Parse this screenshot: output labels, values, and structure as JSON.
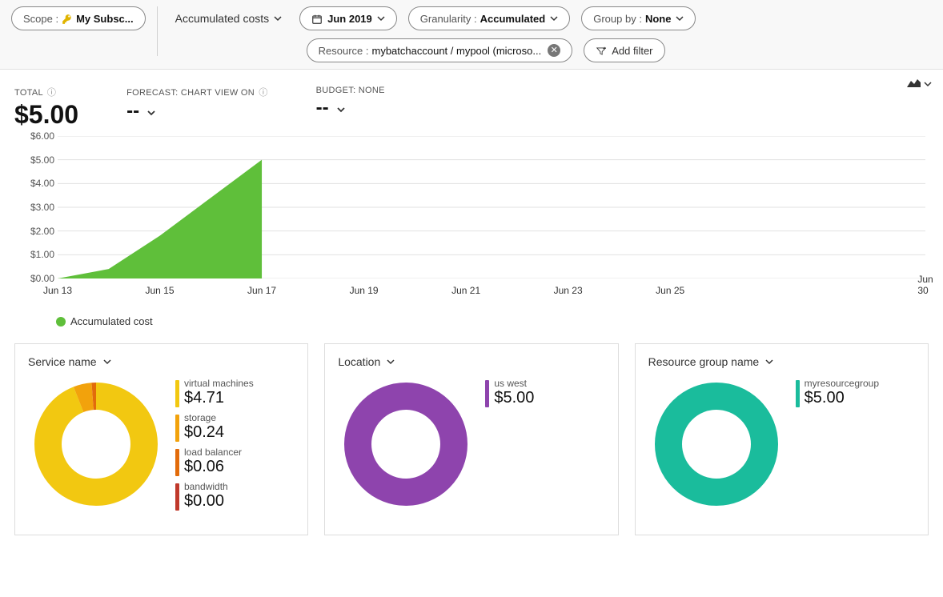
{
  "topbar": {
    "scope": {
      "label": "Scope :",
      "value": "My Subsc..."
    },
    "view": {
      "label": "Accumulated costs"
    },
    "period": {
      "value": "Jun 2019"
    },
    "granularity": {
      "label": "Granularity :",
      "value": "Accumulated"
    },
    "groupby": {
      "label": "Group by :",
      "value": "None"
    },
    "resource": {
      "label": "Resource :",
      "value": "mybatchaccount / mypool (microso..."
    },
    "addfilter": {
      "label": "Add filter"
    }
  },
  "kpi": {
    "total": {
      "label": "TOTAL",
      "value": "$5.00"
    },
    "forecast": {
      "label": "FORECAST: CHART VIEW ON",
      "value": "--"
    },
    "budget": {
      "label": "BUDGET: NONE",
      "value": "--"
    }
  },
  "legend_label": "Accumulated cost",
  "cards": [
    {
      "title": "Service name",
      "items": [
        {
          "name": "virtual machines",
          "value": "$4.71",
          "color": "#f2c811"
        },
        {
          "name": "storage",
          "value": "$0.24",
          "color": "#f2a20c"
        },
        {
          "name": "load balancer",
          "value": "$0.06",
          "color": "#e26b0a"
        },
        {
          "name": "bandwidth",
          "value": "$0.00",
          "color": "#c0392b"
        }
      ]
    },
    {
      "title": "Location",
      "items": [
        {
          "name": "us west",
          "value": "$5.00",
          "color": "#8e44ad"
        }
      ]
    },
    {
      "title": "Resource group name",
      "items": [
        {
          "name": "myresourcegroup",
          "value": "$5.00",
          "color": "#1abc9c"
        }
      ]
    }
  ],
  "chart_data": {
    "type": "area",
    "title": "",
    "xlabel": "",
    "ylabel": "",
    "ylim": [
      0,
      6
    ],
    "yticks": [
      "$0.00",
      "$1.00",
      "$2.00",
      "$3.00",
      "$4.00",
      "$5.00",
      "$6.00"
    ],
    "x_categories": [
      "Jun 13",
      "Jun 15",
      "Jun 17",
      "Jun 19",
      "Jun 21",
      "Jun 23",
      "Jun 25",
      "Jun 30"
    ],
    "series": [
      {
        "name": "Accumulated cost",
        "color": "#5fbf3a",
        "x": [
          "Jun 13",
          "Jun 14",
          "Jun 15",
          "Jun 16",
          "Jun 17"
        ],
        "y": [
          0.0,
          0.4,
          1.8,
          3.4,
          5.0
        ]
      }
    ],
    "donuts": [
      {
        "title": "Service name",
        "slices": [
          {
            "label": "virtual machines",
            "value": 4.71,
            "color": "#f2c811"
          },
          {
            "label": "storage",
            "value": 0.24,
            "color": "#f2a20c"
          },
          {
            "label": "load balancer",
            "value": 0.06,
            "color": "#e26b0a"
          },
          {
            "label": "bandwidth",
            "value": 0.0,
            "color": "#c0392b"
          }
        ]
      },
      {
        "title": "Location",
        "slices": [
          {
            "label": "us west",
            "value": 5.0,
            "color": "#8e44ad"
          }
        ]
      },
      {
        "title": "Resource group name",
        "slices": [
          {
            "label": "myresourcegroup",
            "value": 5.0,
            "color": "#1abc9c"
          }
        ]
      }
    ]
  }
}
